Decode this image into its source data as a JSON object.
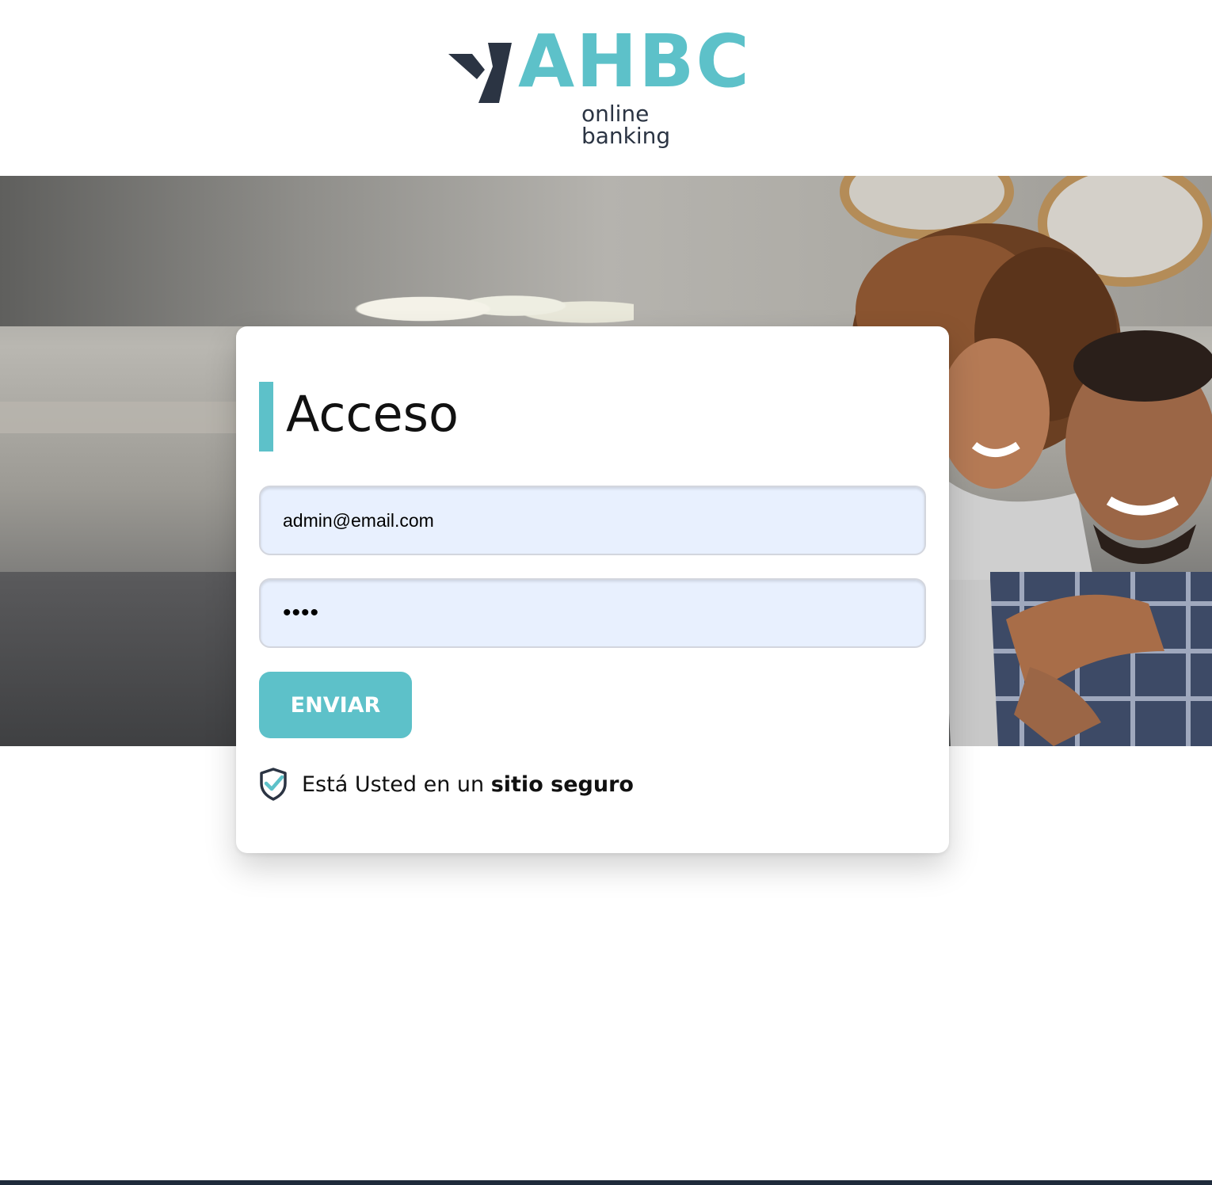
{
  "brand": {
    "name": "AHBC",
    "tagline": "online banking",
    "accent_color": "#5dc1c9",
    "dark_color": "#2b3443",
    "logo_icon": "bird-check-icon"
  },
  "login": {
    "title": "Acceso",
    "email_value": "admin@email.com",
    "password_value": "••••",
    "submit_label": "ENVIAR"
  },
  "security": {
    "icon": "shield-check-icon",
    "text_prefix": "Está Usted en un ",
    "text_bold": "sitio seguro"
  },
  "hero": {
    "description_icon": "hero-photo"
  }
}
